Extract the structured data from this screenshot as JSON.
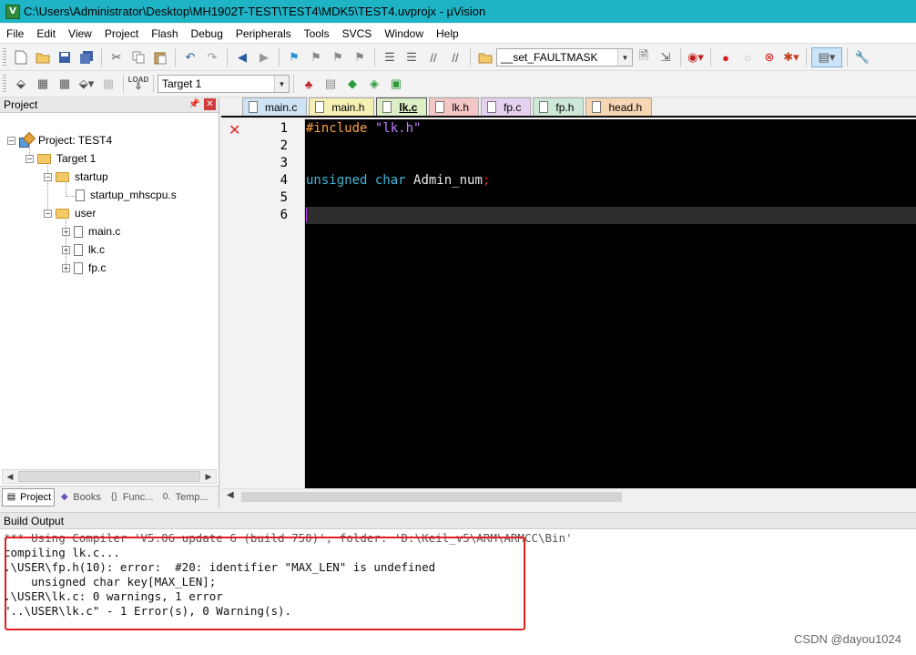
{
  "window": {
    "title": "C:\\Users\\Administrator\\Desktop\\MH1902T-TEST\\TEST4\\MDK5\\TEST4.uvprojx - µVision",
    "app_icon_letter": "V"
  },
  "menu": [
    "File",
    "Edit",
    "View",
    "Project",
    "Flash",
    "Debug",
    "Peripherals",
    "Tools",
    "SVCS",
    "Window",
    "Help"
  ],
  "toolbar1": {
    "combo_value": "__set_FAULTMASK"
  },
  "toolbar2": {
    "target_value": "Target 1",
    "load_label": "LOAD"
  },
  "project_panel": {
    "title": "Project",
    "tree": {
      "project": "Project: TEST4",
      "target": "Target 1",
      "group1": "startup",
      "group1_file": "startup_mhscpu.s",
      "group2": "user",
      "files": [
        "main.c",
        "lk.c",
        "fp.c"
      ]
    },
    "tabs": [
      "Project",
      "Books",
      "Func...",
      "Temp..."
    ]
  },
  "editor": {
    "tabs": [
      {
        "label": "main.c",
        "color": "#cfe3f5"
      },
      {
        "label": "main.h",
        "color": "#f7f0b4"
      },
      {
        "label": "lk.c",
        "color": "#dcefc4"
      },
      {
        "label": "lk.h",
        "color": "#f5c6c6"
      },
      {
        "label": "fp.c",
        "color": "#e6d2f0"
      },
      {
        "label": "fp.h",
        "color": "#cde8d6"
      },
      {
        "label": "head.h",
        "color": "#f7d6b4"
      }
    ],
    "active_tab": "lk.c",
    "line_numbers": [
      "1",
      "2",
      "3",
      "4",
      "5",
      "6"
    ],
    "code": {
      "line1_directive": "#include",
      "line1_string": "\"lk.h\"",
      "line4_type": "unsigned char",
      "line4_ident": "Admin_num",
      "line4_punct": ";"
    }
  },
  "build_output": {
    "title": "Build Output",
    "lines": [
      "*** Using Compiler 'V5.06 update 6 (build 750)', folder: 'D:\\Keil_v5\\ARM\\ARMCC\\Bin'",
      "compiling lk.c...",
      ".\\USER\\fp.h(10): error:  #20: identifier \"MAX_LEN\" is undefined",
      "    unsigned char key[MAX_LEN];",
      ".\\USER\\lk.c: 0 warnings, 1 error",
      "\"..\\USER\\lk.c\" - 1 Error(s), 0 Warning(s)."
    ]
  },
  "watermark": "CSDN @dayou1024"
}
